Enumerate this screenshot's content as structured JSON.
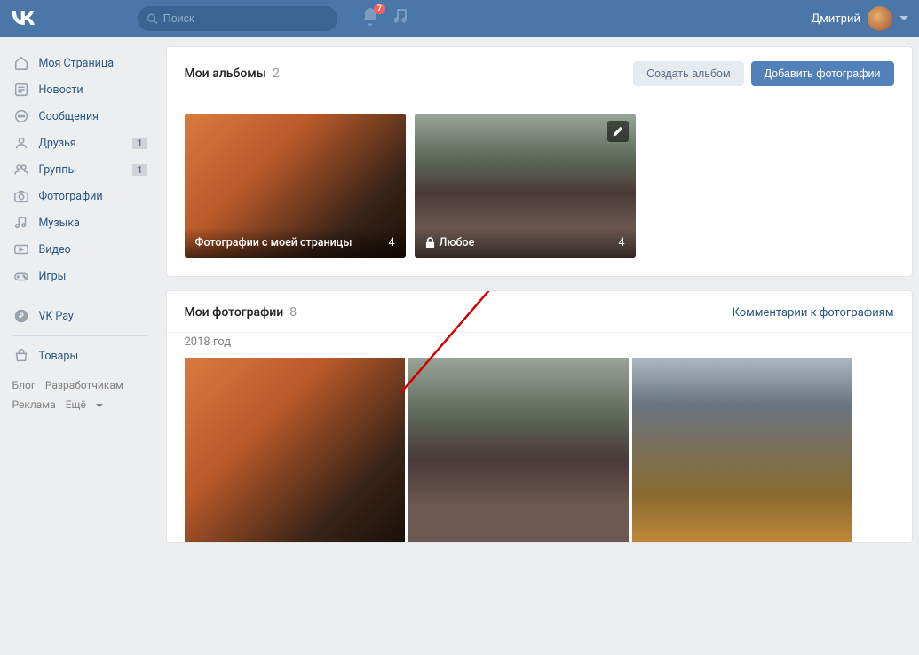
{
  "header": {
    "search_placeholder": "Поиск",
    "notif_count": "7",
    "username": "Дмитрий"
  },
  "sidebar": {
    "items": [
      {
        "label": "Моя Страница"
      },
      {
        "label": "Новости"
      },
      {
        "label": "Сообщения"
      },
      {
        "label": "Друзья",
        "badge": "1"
      },
      {
        "label": "Группы",
        "badge": "1"
      },
      {
        "label": "Фотографии"
      },
      {
        "label": "Музыка"
      },
      {
        "label": "Видео"
      },
      {
        "label": "Игры"
      }
    ],
    "sep1": [
      {
        "label": "VK Pay"
      }
    ],
    "sep2": [
      {
        "label": "Товары"
      }
    ]
  },
  "footer": {
    "blog": "Блог",
    "developers": "Разработчикам",
    "ads": "Реклама",
    "more": "Ещё"
  },
  "albums_section": {
    "title": "Мои альбомы",
    "count": "2",
    "create_btn": "Создать альбом",
    "add_btn": "Добавить фотографии",
    "items": [
      {
        "title": "Фотографии с моей страницы",
        "count": "4"
      },
      {
        "title": "Любое",
        "count": "4"
      }
    ]
  },
  "photos_section": {
    "title": "Мои фотографии",
    "count": "8",
    "comments_link": "Комментарии к фотографиям",
    "year": "2018 год"
  }
}
